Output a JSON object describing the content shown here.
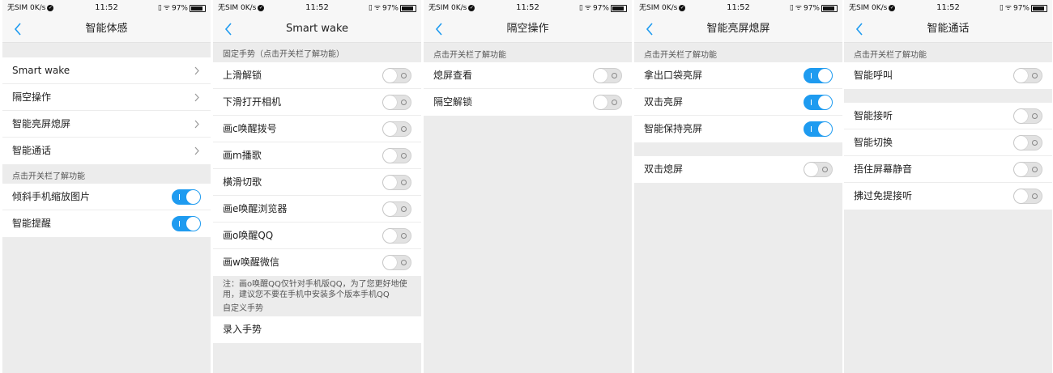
{
  "status": {
    "carrier": "无SIM 0K/s",
    "time": "11:52",
    "battery": "97%",
    "check_glyph": "✓",
    "vibrate_glyph": "▯",
    "wifi_glyph": "ᯤ"
  },
  "screens": [
    {
      "title": "智能体感",
      "nav_items": [
        "Smart wake",
        "隔空操作",
        "智能亮屏熄屏",
        "智能通话"
      ],
      "section_label": "点击开关栏了解功能",
      "toggles": [
        {
          "label": "倾斜手机缩放图片",
          "on": true
        },
        {
          "label": "智能提醒",
          "on": true
        }
      ]
    },
    {
      "title": "Smart wake",
      "section_label": "固定手势（点击开关栏了解功能）",
      "toggles": [
        {
          "label": "上滑解锁",
          "on": false
        },
        {
          "label": "下滑打开相机",
          "on": false
        },
        {
          "label": "画c唤醒拨号",
          "on": false
        },
        {
          "label": "画m播歌",
          "on": false
        },
        {
          "label": "横滑切歌",
          "on": false
        },
        {
          "label": "画e唤醒浏览器",
          "on": false
        },
        {
          "label": "画o唤醒QQ",
          "on": false
        },
        {
          "label": "画w唤醒微信",
          "on": false
        }
      ],
      "note": "注：画o唤醒QQ仅针对手机版QQ，为了您更好地使用，建议您不要在手机中安装多个版本手机QQ",
      "custom_label": "自定义手势",
      "custom_item": "录入手势"
    },
    {
      "title": "隔空操作",
      "section_label": "点击开关栏了解功能",
      "toggles": [
        {
          "label": "熄屏查看",
          "on": false
        },
        {
          "label": "隔空解锁",
          "on": false
        }
      ]
    },
    {
      "title": "智能亮屏熄屏",
      "section_label": "点击开关栏了解功能",
      "toggles": [
        {
          "label": "拿出口袋亮屏",
          "on": true
        },
        {
          "label": "双击亮屏",
          "on": true
        },
        {
          "label": "智能保持亮屏",
          "on": true
        }
      ],
      "toggles2": [
        {
          "label": "双击熄屏",
          "on": false
        }
      ]
    },
    {
      "title": "智能通话",
      "section_label": "点击开关栏了解功能",
      "toggles": [
        {
          "label": "智能呼叫",
          "on": false
        }
      ],
      "toggles2": [
        {
          "label": "智能接听",
          "on": false
        },
        {
          "label": "智能切换",
          "on": false
        },
        {
          "label": "捂住屏幕静音",
          "on": false
        },
        {
          "label": "拂过免提接听",
          "on": false
        }
      ]
    }
  ]
}
